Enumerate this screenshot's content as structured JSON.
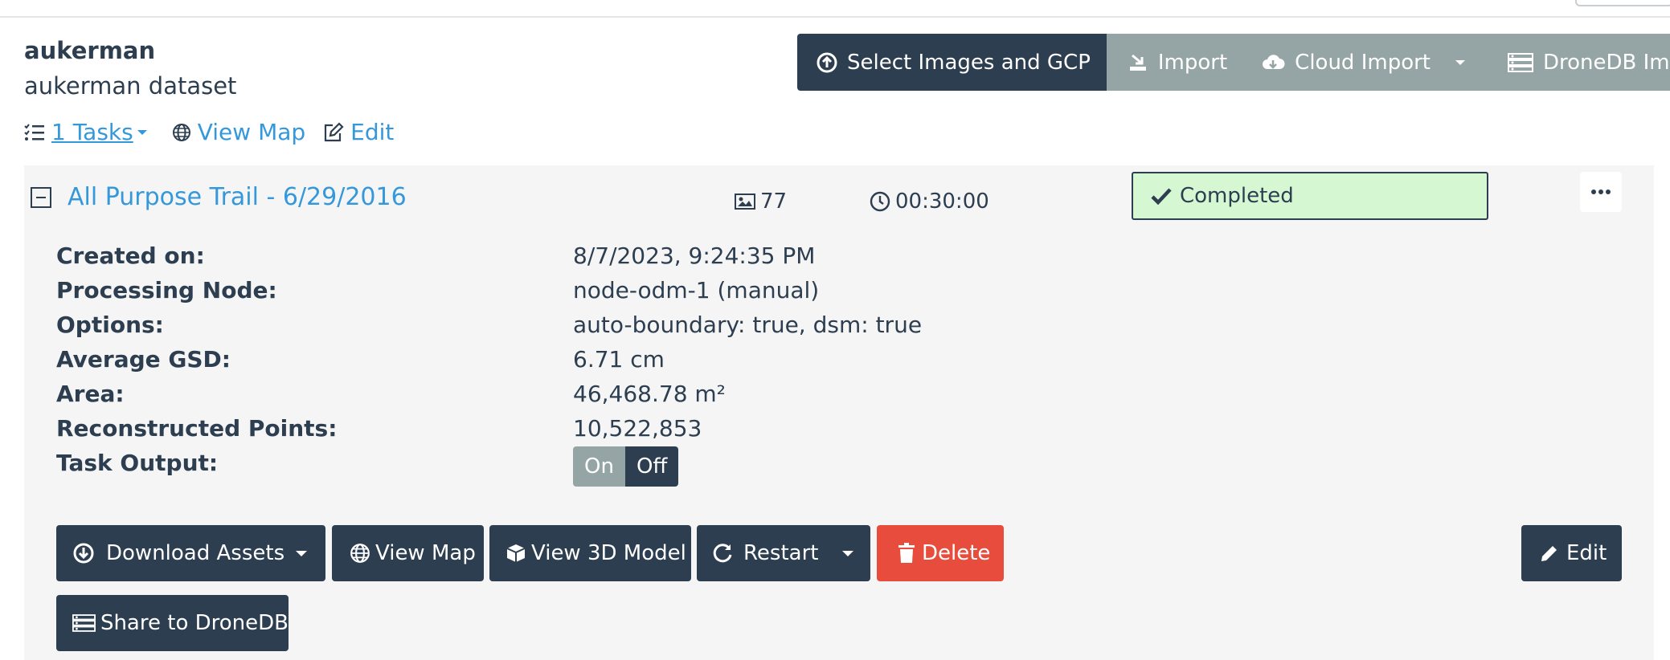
{
  "project": {
    "name": "aukerman",
    "description": "aukerman dataset"
  },
  "toolbar": {
    "select_images": "Select Images and GCP",
    "import": "Import",
    "cloud_import": "Cloud Import",
    "dronedb_import": "DroneDB Import"
  },
  "links": {
    "tasks": "1 Tasks",
    "view_map": "View Map",
    "edit": "Edit"
  },
  "task": {
    "name": "All Purpose Trail - 6/29/2016",
    "image_count": "77",
    "duration": "00:30:00",
    "status": "Completed",
    "status_color": "#d5f8d3",
    "details": [
      {
        "label": "Created on:",
        "value": "8/7/2023, 9:24:35 PM"
      },
      {
        "label": "Processing Node:",
        "value": "node-odm-1 (manual)"
      },
      {
        "label": "Options:",
        "value": "auto-boundary: true, dsm: true"
      },
      {
        "label": "Average GSD:",
        "value": "6.71 cm"
      },
      {
        "label": "Area:",
        "value": "46,468.78 m²"
      },
      {
        "label": "Reconstructed Points:",
        "value": "10,522,853"
      },
      {
        "label": "Task Output:",
        "value": ""
      }
    ],
    "output_toggle": {
      "on": "On",
      "off": "Off",
      "selected": "Off"
    }
  },
  "actions": {
    "download_assets": "Download Assets",
    "view_map": "View Map",
    "view_3d_model": "View 3D Model",
    "restart": "Restart",
    "delete": "Delete",
    "edit": "Edit",
    "share_dronedb": "Share to DroneDB"
  },
  "colors": {
    "primary": "#2c3e50",
    "secondary": "#95a5a6",
    "link": "#3498db",
    "danger": "#e74c3c"
  }
}
